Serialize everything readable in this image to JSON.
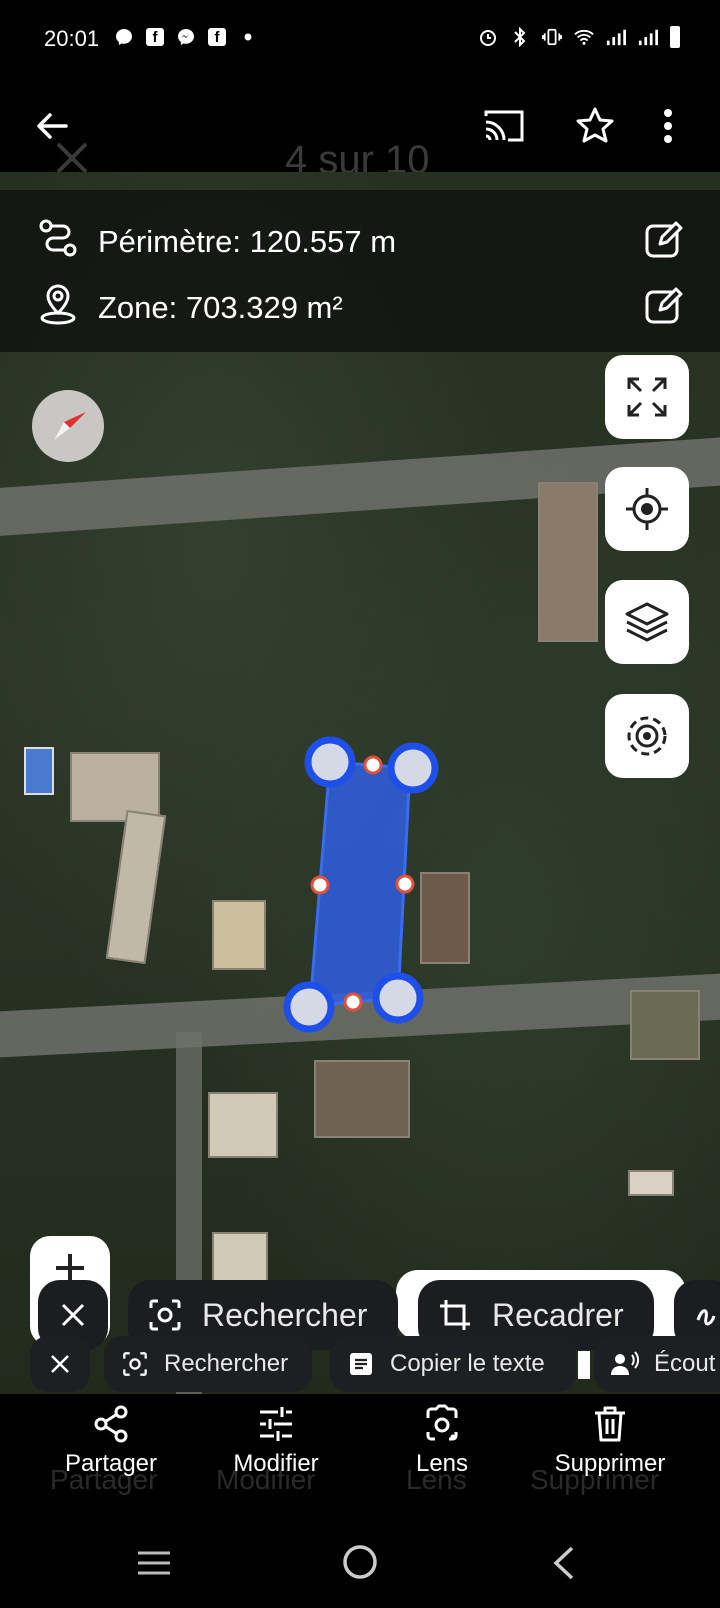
{
  "status_bar": {
    "time": "20:01",
    "left_icons": [
      "messenger-icon",
      "facebook-icon",
      "messenger-icon",
      "facebook-icon",
      "dot-icon"
    ],
    "right_icons": [
      "alarm-icon",
      "bluetooth-icon",
      "vibrate-icon",
      "wifi-icon",
      "signal-icon",
      "signal-icon",
      "battery-icon"
    ]
  },
  "app_bar": {
    "ghost_title": "4 sur 10",
    "icons": [
      "back-arrow-icon",
      "cast-icon",
      "star-icon",
      "more-vert-icon"
    ]
  },
  "measure": {
    "perimeter": "Périmètre: 120.557 m",
    "area": "Zone: 703.329 m²"
  },
  "map_controls": [
    "fullscreen-icon",
    "my-location-icon",
    "layers-icon",
    "gps-tracking-icon"
  ],
  "lens_chips_large": {
    "search": "Rechercher",
    "crop": "Recadrer"
  },
  "lens_chips_small": {
    "search": "Rechercher",
    "copy_text": "Copier le texte",
    "listen": "Écout"
  },
  "bottom_actions": {
    "share": "Partager",
    "edit": "Modifier",
    "lens": "Lens",
    "delete": "Supprimer"
  },
  "ghost_bottom_actions": {
    "share": "Partager",
    "edit": "Modifier",
    "lens": "Lens",
    "delete": "Supprimer"
  },
  "colors": {
    "polygon_fill": "#2f5fe0",
    "polygon_vertex": "#1e4fe8",
    "midpoint": "#e2503c"
  }
}
